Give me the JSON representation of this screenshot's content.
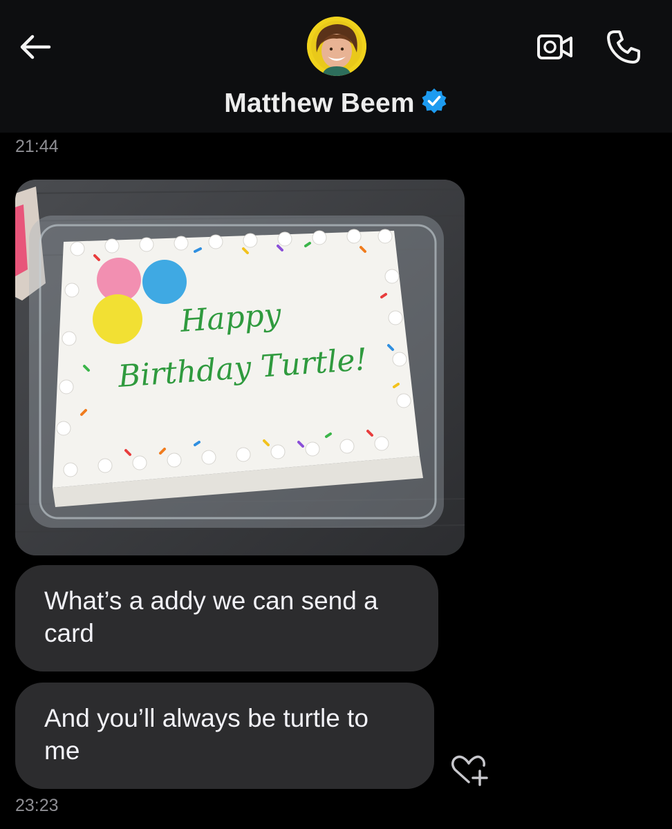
{
  "header": {
    "contact_name": "Matthew Beem",
    "verified_color": "#1d9bf0",
    "icons": {
      "back": "arrow-left-icon",
      "video": "video-camera-icon",
      "call": "phone-icon",
      "verified": "verified-badge-icon"
    }
  },
  "messages": [
    {
      "type": "timestamp",
      "text": "21:44"
    },
    {
      "type": "image",
      "cake_text": [
        "Happy",
        "Birthday Turtle!"
      ]
    },
    {
      "type": "text",
      "text": "What’s a addy we can send a card"
    },
    {
      "type": "text",
      "text": "And you’ll always be turtle to me"
    },
    {
      "type": "timestamp",
      "text": "23:23"
    }
  ],
  "actions": {
    "react_icon": "heart-plus-icon"
  },
  "colors": {
    "bubble": "#2c2c2e",
    "background": "#000000",
    "header": "#0d0e10"
  }
}
